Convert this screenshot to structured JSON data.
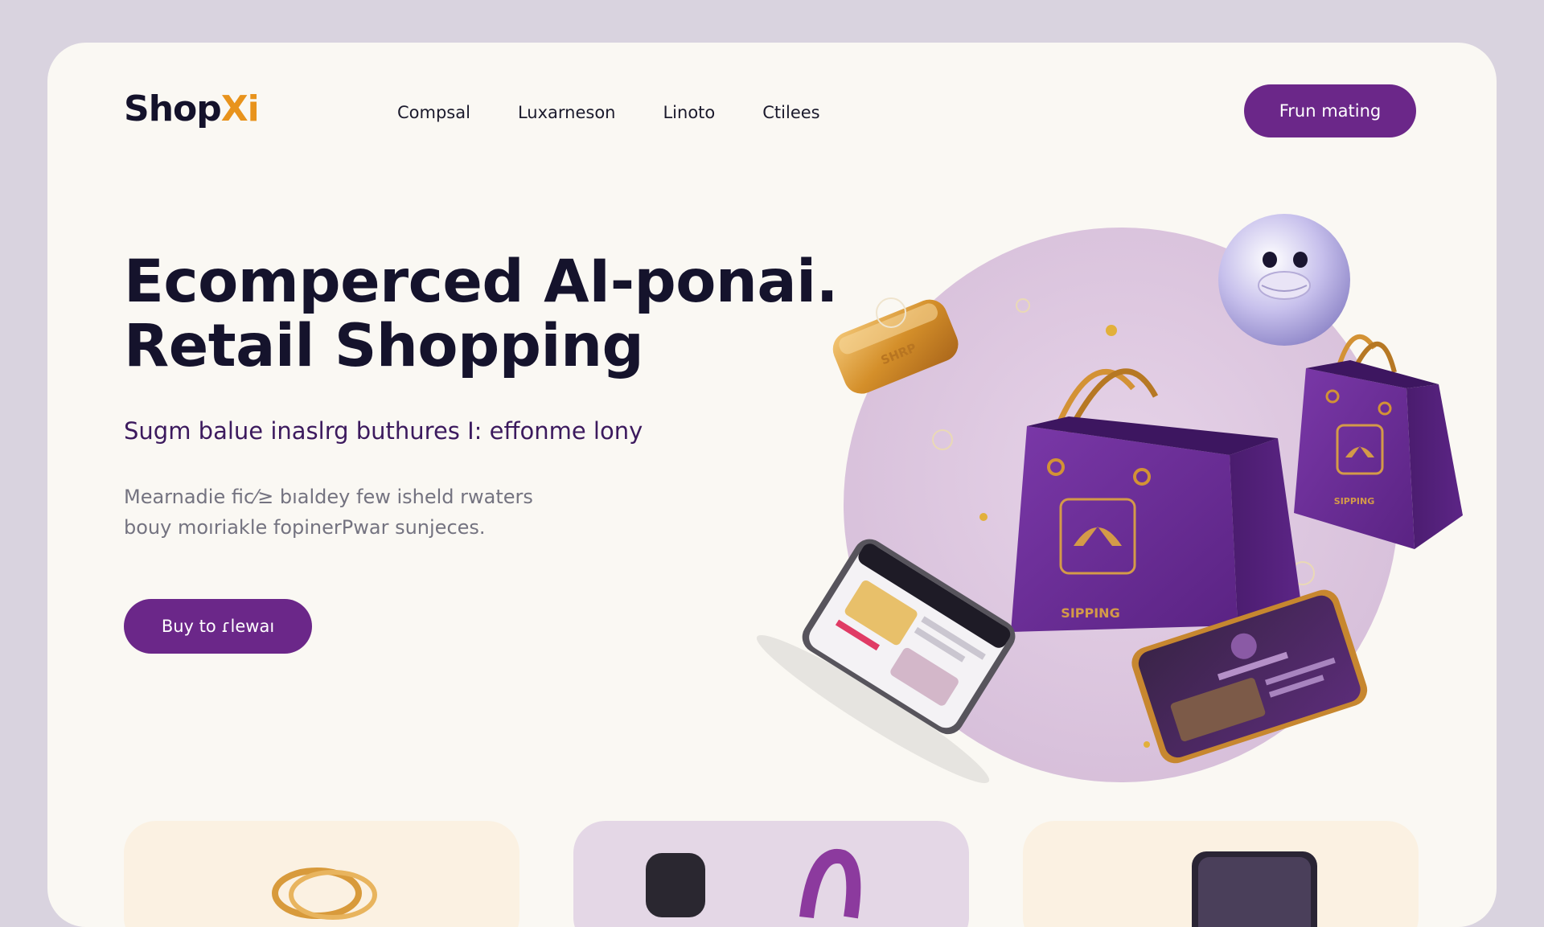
{
  "brand": {
    "name_part1": "Shop",
    "name_part2": "Xi",
    "accent_color": "#e8931c",
    "primary_color": "#6b2789"
  },
  "nav": {
    "items": [
      "Compsal",
      "Luxarneson",
      "Linoto",
      "Ctilees"
    ]
  },
  "header": {
    "cta_label": "Frun mating"
  },
  "hero": {
    "title_line1": "Ecomperced AI-ponai.",
    "title_line2": "Retail Shopping",
    "subtitle": "Sugm balue inaslrg buthures I: effonme lony",
    "body_line1": "Mearnadie fic⁄≥ bıaldey few isheld rwaters",
    "body_line2": "bouy moıriakle fopinerPwar sunjeces.",
    "cta_label": "Buy to ɾlewaı",
    "illustration": {
      "bag_label": "SIPPING",
      "bag_label_small": "SIPPING",
      "gold_block_label": "SHRP"
    }
  },
  "cards": [
    {
      "icon": "gold-ring-icon"
    },
    {
      "icon": "smartwatch-icon"
    },
    {
      "icon": "smartphone-icon"
    }
  ]
}
